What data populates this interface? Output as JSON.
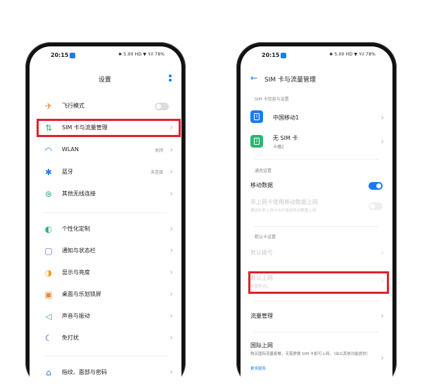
{
  "left": {
    "status": {
      "time": "20:15",
      "right": "✱ 5.00 HD ▼ Yıl 78%"
    },
    "header": {
      "title": "设置"
    },
    "items": [
      {
        "icon": "airplane-icon",
        "label": "飞行模式",
        "value": ""
      },
      {
        "icon": "sim-data-icon",
        "label": "SIM 卡与流量管理",
        "value": ""
      },
      {
        "icon": "wifi-icon",
        "label": "WLAN",
        "value": "关闭"
      },
      {
        "icon": "bluetooth-icon",
        "label": "蓝牙",
        "value": "未连接"
      },
      {
        "icon": "wireless-icon",
        "label": "其他无线连接",
        "value": ""
      },
      {
        "icon": "palette-icon",
        "label": "个性化定制",
        "value": ""
      },
      {
        "icon": "notification-icon",
        "label": "通知与状态栏",
        "value": ""
      },
      {
        "icon": "brightness-icon",
        "label": "显示与亮度",
        "value": ""
      },
      {
        "icon": "wallpaper-icon",
        "label": "桌面与乐划锁屏",
        "value": ""
      },
      {
        "icon": "sound-icon",
        "label": "声音与振动",
        "value": ""
      },
      {
        "icon": "moon-icon",
        "label": "免打扰",
        "value": ""
      },
      {
        "icon": "fingerprint-icon",
        "label": "指纹、面部与密码",
        "value": ""
      }
    ]
  },
  "right": {
    "status": {
      "time": "20:15",
      "right": "✱ 5.00 HD ▼ Yıl 78%"
    },
    "header": {
      "title": "SIM 卡与流量管理"
    },
    "sim_section": "SIM 卡信息与设置",
    "sims": [
      {
        "label": "中国移动1",
        "sub": "",
        "color": "#1a7cf5",
        "num": "1"
      },
      {
        "label": "无 SIM 卡",
        "sub": "卡槽2",
        "color": "#2bb673",
        "num": "2"
      }
    ],
    "general_section": "通用设置",
    "mobile_data": "移动数据",
    "non_default": {
      "label": "非上网卡使用移动数据上网",
      "sub": "通话时非上网卡也可使用移动数据上网"
    },
    "default_section": "默认卡设置",
    "default_call": {
      "label": "默认拨号",
      "sub": ""
    },
    "default_data": {
      "label": "默认上网",
      "sub": "中国移动1"
    },
    "traffic": "流量管理",
    "intl": {
      "label": "国际上网",
      "desc": "购买国际流量套餐，无需更换 SIM 卡即可上网。（由以其他功能提供）",
      "link": "更多服务"
    }
  }
}
